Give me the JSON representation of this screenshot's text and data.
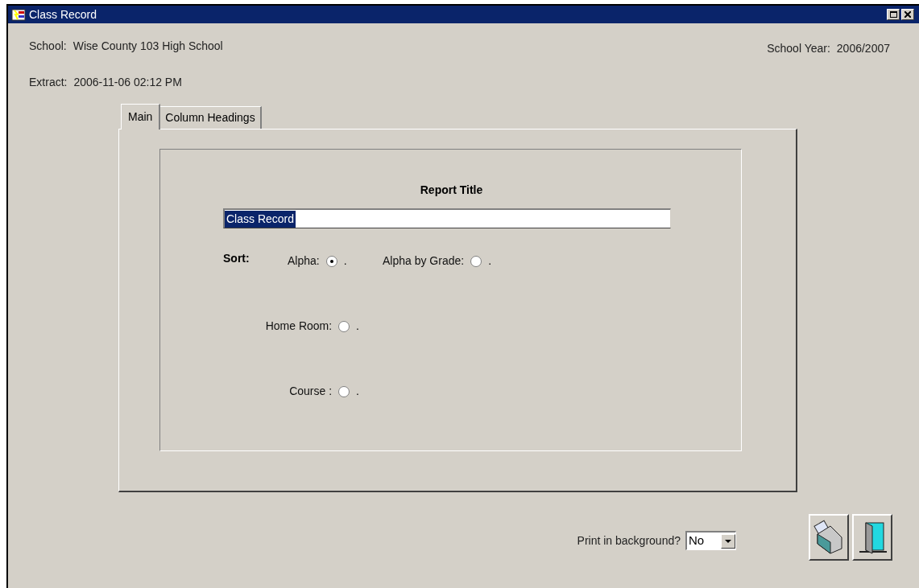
{
  "window": {
    "title": "Class Record"
  },
  "header": {
    "school_label": "School:",
    "school": "Wise County 103 High School",
    "extract_label": "Extract:",
    "extract": "2006-11-06 02:12 PM",
    "year_label": "School Year:",
    "year": "2006/2007"
  },
  "tabs": [
    {
      "label": "Main",
      "selected": true
    },
    {
      "label": "Column Headings",
      "selected": false
    }
  ],
  "report_title": {
    "label": "Report Title",
    "value": "Class Record",
    "highlighted": true
  },
  "sort": {
    "label": "Sort:",
    "options": [
      {
        "label": "Alpha:",
        "selected": true,
        "suffix": "."
      },
      {
        "label": "Alpha by Grade:",
        "selected": false,
        "suffix": "."
      },
      {
        "label": "Home Room:",
        "selected": false,
        "suffix": "."
      },
      {
        "label": "Course :",
        "selected": false,
        "suffix": "."
      }
    ]
  },
  "print_background": {
    "label": "Print in background?",
    "value": "No"
  }
}
